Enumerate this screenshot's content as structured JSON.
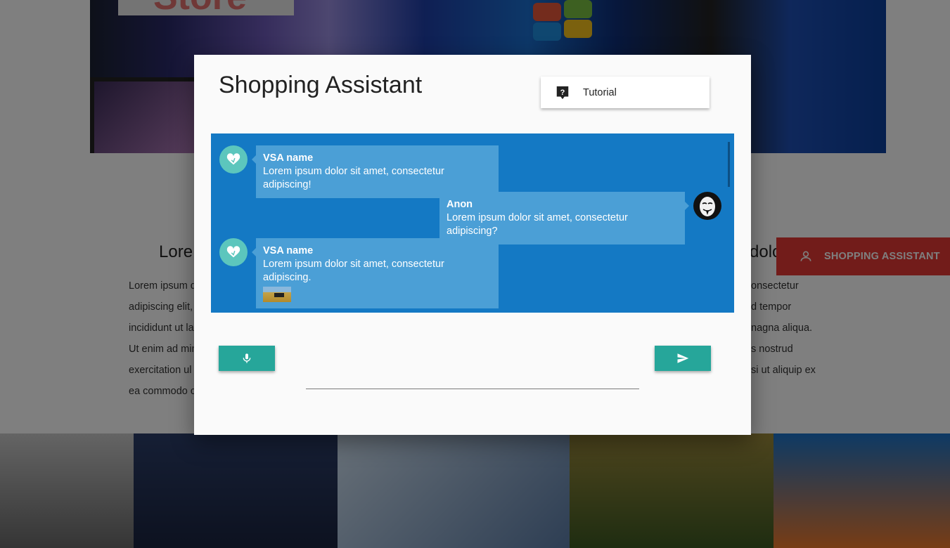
{
  "background": {
    "store_title": "Store",
    "section_heading_left": "Lore",
    "section_heading_right": "dolo",
    "left_text_lines": [
      "Lorem ipsum d",
      "adipiscing elit,",
      "incididunt ut la",
      "Ut enim ad min",
      "exercitation ul",
      "ea commodo c"
    ],
    "right_text_lines": [
      "onsectetur",
      "d tempor",
      "nagna aliqua.",
      "s nostrud",
      "si ut aliquip ex",
      ""
    ],
    "shopping_assistant_tab": "SHOPPING ASSISTANT",
    "tab_color": "#e53935"
  },
  "modal": {
    "title": "Shopping Assistant",
    "tutorial_label": "Tutorial",
    "accent_color": "#26a69a",
    "chat_bg_color": "#1479c4",
    "messages": [
      {
        "sender": "VSA name",
        "text": "Lorem ipsum dolor sit amet, consectetur adipiscing!",
        "side": "left",
        "avatar": "heart-chat-icon"
      },
      {
        "sender": "Anon",
        "text": "Lorem ipsum dolor sit amet, consectetur adipiscing?",
        "side": "right",
        "avatar": "anonymous-mask-icon"
      },
      {
        "sender": "VSA name",
        "text": "Lorem ipsum dolor sit amet, consectetur adipiscing.",
        "side": "left",
        "avatar": "heart-chat-icon",
        "has_image": true
      }
    ],
    "input_value": "",
    "input_placeholder": ""
  }
}
